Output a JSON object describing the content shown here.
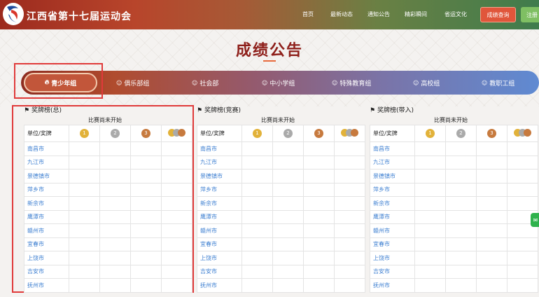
{
  "header": {
    "site_title": "江西省第十七届运动会",
    "nav": [
      "首页",
      "最新动态",
      "通知公告",
      "精彩瞬间",
      "省运文化"
    ],
    "btn_query": "成绩查询",
    "btn_register": "注册"
  },
  "page_title": "成绩公告",
  "tabs": [
    {
      "label": "青少年组",
      "icon": "flame-icon",
      "active": true
    },
    {
      "label": "俱乐部组",
      "icon": "users-icon"
    },
    {
      "label": "社会部",
      "icon": "users-icon"
    },
    {
      "label": "中小学组",
      "icon": "users-icon"
    },
    {
      "label": "特殊教育组",
      "icon": "users-icon"
    },
    {
      "label": "高校组",
      "icon": "users-icon"
    },
    {
      "label": "教职工组",
      "icon": "users-icon"
    }
  ],
  "panels": [
    {
      "title": "奖牌榜(总)",
      "status": "比赛尚未开始"
    },
    {
      "title": "奖牌榜(竞赛)",
      "status": "比赛尚未开始"
    },
    {
      "title": "奖牌榜(带入)",
      "status": "比赛尚未开始"
    }
  ],
  "table": {
    "header_label": "单位/奖牌",
    "medal_labels": [
      "1",
      "2",
      "3"
    ],
    "cities": [
      "南昌市",
      "九江市",
      "景德镇市",
      "萍乡市",
      "新余市",
      "鹰潭市",
      "赣州市",
      "宜春市",
      "上饶市",
      "吉安市",
      "抚州市"
    ]
  },
  "colors": {
    "accent": "#8e1f1a",
    "highlight": "#e03a3a",
    "city_link": "#3d7fd1",
    "gold": "#e2b23a",
    "silver": "#aaaaaa",
    "bronze": "#c77a3e"
  }
}
